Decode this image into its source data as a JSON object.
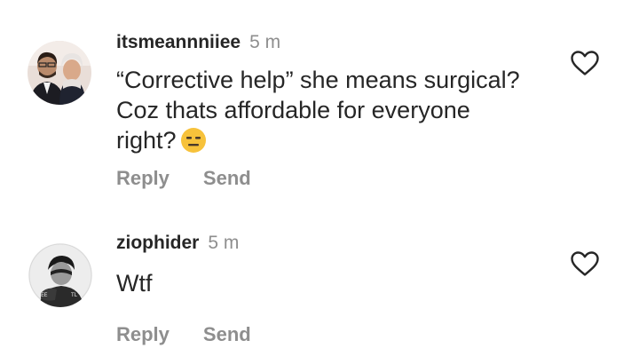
{
  "comments": [
    {
      "username": "itsmeannniiee",
      "time": "5 m",
      "lines": [
        "“Corrective help” she means surgical?",
        "Coz thats affordable for everyone",
        "right?"
      ],
      "emoji": "expressionless-face",
      "reply_label": "Reply",
      "send_label": "Send"
    },
    {
      "username": "ziophider",
      "time": "5 m",
      "lines": [
        "Wtf"
      ],
      "reply_label": "Reply",
      "send_label": "Send"
    }
  ],
  "colors": {
    "text": "#262626",
    "secondary": "#8e8e8e",
    "emoji": "#f7c23b"
  },
  "icons": [
    "heart-outline-icon",
    "expressionless-face-emoji"
  ]
}
